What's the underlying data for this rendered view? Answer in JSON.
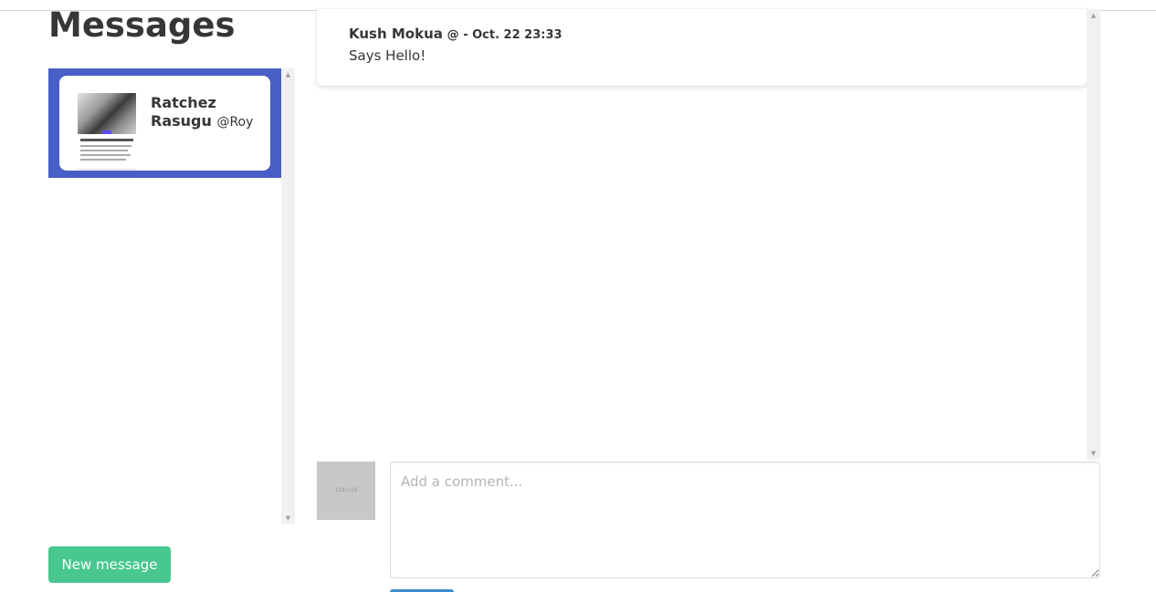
{
  "page": {
    "title": "Messages"
  },
  "conversations": [
    {
      "name": "Ratchez Rasugu",
      "handle": "@Roy",
      "thumbnail_icon": "article-preview-image"
    }
  ],
  "new_message_label": "New message",
  "messages": [
    {
      "author": "Kush Mokua",
      "meta": "@ - Oct. 22 23:33",
      "text": "Says Hello!"
    }
  ],
  "composer": {
    "avatar_placeholder": "128×128",
    "placeholder": "Add a comment..."
  },
  "colors": {
    "selected_item_bg": "#485fc7",
    "primary_button": "#48c78e",
    "submit_button": "#3e8ed0",
    "text": "#363636"
  }
}
